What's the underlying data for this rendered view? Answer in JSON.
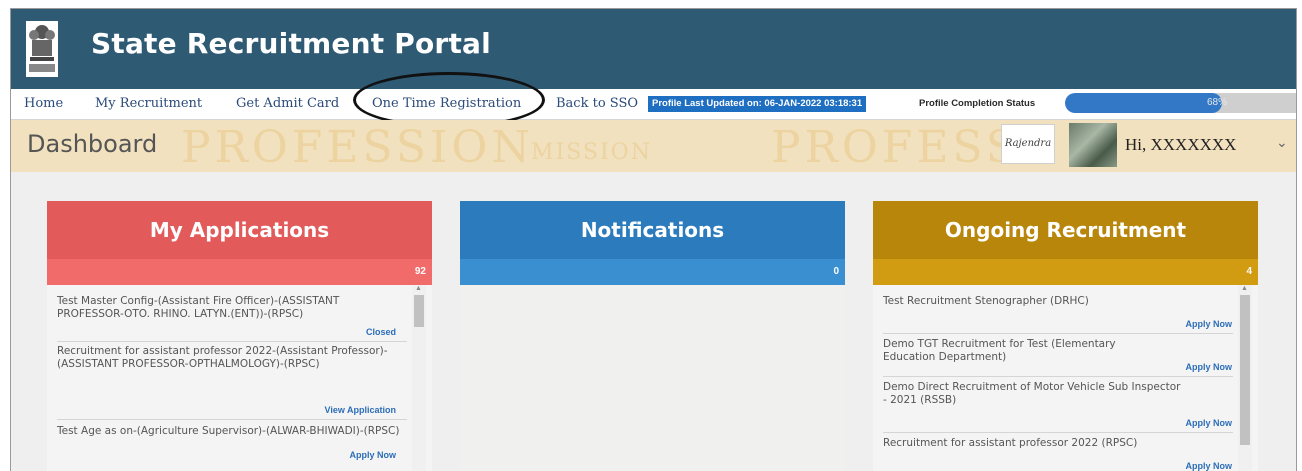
{
  "header": {
    "title": "State Recruitment Portal",
    "emblem_icon": "state-emblem-icon"
  },
  "nav": {
    "items": [
      {
        "label": "Home"
      },
      {
        "label": "My Recruitment"
      },
      {
        "label": "Get Admit Card"
      },
      {
        "label": "One Time Registration"
      },
      {
        "label": "Back to SSO"
      }
    ],
    "profile_updated": "Profile Last Updated on: 06-JAN-2022 03:18:31",
    "completion_label": "Profile Completion Status",
    "completion_percent": 68,
    "completion_text": "68%"
  },
  "dashboard": {
    "title": "Dashboard",
    "watermark": "PROFESSION",
    "watermark_small": "MISSION",
    "watermark_right": "PROFESS",
    "signature_text": "Rajendra",
    "greeting": "Hi, XXXXXXX"
  },
  "panels": {
    "applications": {
      "title": "My Applications",
      "count": "92",
      "color": "#e25a5a",
      "sub_color": "#f26b6b",
      "items": [
        {
          "text": "Test Master Config-(Assistant Fire Officer)-(ASSISTANT PROFESSOR-OTO. RHINO. LATYN.(ENT))-(RPSC)",
          "action": "Closed"
        },
        {
          "text": "Recruitment for assistant professor 2022-(Assistant Professor)-(ASSISTANT PROFESSOR-OPTHALMOLOGY)-(RPSC)",
          "action": "View Application"
        },
        {
          "text": "Test Age as on-(Agriculture Supervisor)-(ALWAR-BHIWADI)-(RPSC)",
          "action": "Apply Now"
        }
      ]
    },
    "notifications": {
      "title": "Notifications",
      "count": "0",
      "color": "#2b7bbd",
      "sub_color": "#3a8fd1"
    },
    "ongoing": {
      "title": "Ongoing Recruitment",
      "count": "4",
      "color": "#b8860b",
      "sub_color": "#d19b12",
      "items": [
        {
          "text": "Test Recruitment Stenographer (DRHC)",
          "action": "Apply Now"
        },
        {
          "text": "Demo TGT Recruitment for Test (Elementary Education Department)",
          "action": "Apply Now"
        },
        {
          "text": "Demo Direct Recruitment of Motor Vehicle Sub Inspector - 2021 (RSSB)",
          "action": "Apply Now"
        },
        {
          "text": "Recruitment for assistant professor 2022 (RPSC)",
          "action": "Apply Now"
        }
      ]
    }
  }
}
